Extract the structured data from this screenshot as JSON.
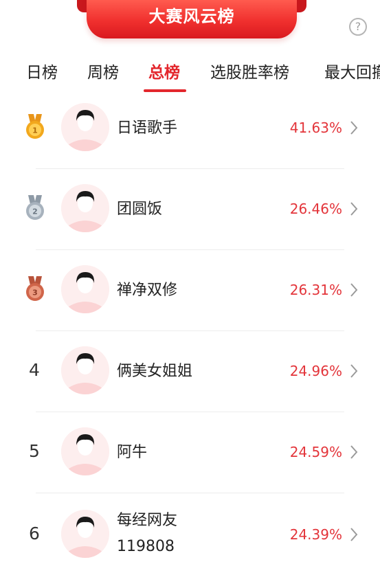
{
  "header": {
    "title": "大赛风云榜",
    "help_icon_glyph": "?"
  },
  "tabs": [
    {
      "label": "日榜",
      "active": false
    },
    {
      "label": "周榜",
      "active": false
    },
    {
      "label": "总榜",
      "active": true
    },
    {
      "label": "选股胜率榜",
      "active": false
    },
    {
      "label": "最大回撤",
      "active": false
    }
  ],
  "rankings": [
    {
      "rank": "1",
      "medal": "gold-medal-icon",
      "name": "日语歌手",
      "name_line2": "",
      "rate": "41.63%"
    },
    {
      "rank": "2",
      "medal": "silver-medal-icon",
      "name": "团圆饭",
      "name_line2": "",
      "rate": "26.46%"
    },
    {
      "rank": "3",
      "medal": "bronze-medal-icon",
      "name": "禅净双修",
      "name_line2": "",
      "rate": "26.31%"
    },
    {
      "rank": "4",
      "medal": "",
      "name": "俩美女姐姐",
      "name_line2": "",
      "rate": "24.96%"
    },
    {
      "rank": "5",
      "medal": "",
      "name": "阿牛",
      "name_line2": "",
      "rate": "24.59%"
    },
    {
      "rank": "6",
      "medal": "",
      "name": "每经网友",
      "name_line2": "119808",
      "rate": "24.39%"
    }
  ],
  "colors": {
    "accent": "#e3262c",
    "rate_text": "#e3343a",
    "banner_top": "#ff5b4f",
    "banner_bottom": "#d9191f",
    "gold": "#f2a81d",
    "silver": "#a7b2bd",
    "bronze": "#d0654a",
    "avatar_bg": "#fdeeee"
  }
}
